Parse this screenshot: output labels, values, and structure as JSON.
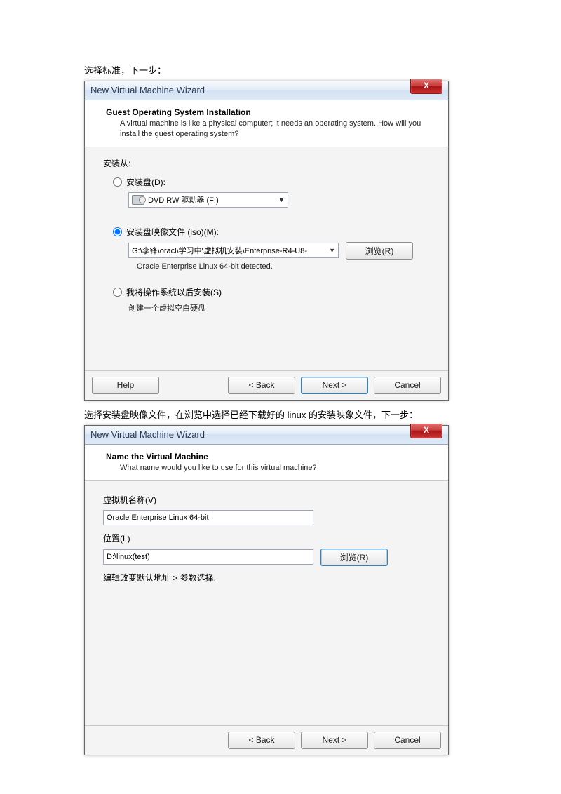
{
  "caption1": "选择标准，下一步：",
  "caption2": "选择安装盘映像文件，在浏览中选择已经下载好的 linux 的安装映象文件，下一步：",
  "dialog1": {
    "title": "New Virtual Machine Wizard",
    "close_x": "X",
    "banner_title": "Guest Operating System Installation",
    "banner_sub": "A virtual machine is like a physical computer; it needs an operating system. How will you install the guest operating system?",
    "install_from": "安装从:",
    "opt_disc": "安装盘(D):",
    "drive_text": "DVD RW 驱动器 (F:)",
    "opt_iso": "安装盘映像文件 (iso)(M):",
    "iso_path": "G:\\李锋\\oracl\\学习中\\虚拟机安装\\Enterprise-R4-U8-",
    "browse": "浏览(R)",
    "detected": "Oracle Enterprise Linux 64-bit detected.",
    "opt_later": "我将操作系统以后安装(S)",
    "later_sub": "创建一个虚拟空白硬盘",
    "help": "Help",
    "back": "< Back",
    "next": "Next >",
    "cancel": "Cancel"
  },
  "dialog2": {
    "title": "New Virtual Machine Wizard",
    "close_x": "X",
    "banner_title": "Name the Virtual Machine",
    "banner_sub": "What name would you like to use for this virtual machine?",
    "name_label": "虚拟机名称(V)",
    "name_value": "Oracle Enterprise Linux 64-bit",
    "loc_label": "位置(L)",
    "loc_value": "D:\\linux(test)",
    "browse": "浏览(R)",
    "hint": "编辑改变默认地址 > 参数选择.",
    "back": "< Back",
    "next": "Next >",
    "cancel": "Cancel"
  }
}
